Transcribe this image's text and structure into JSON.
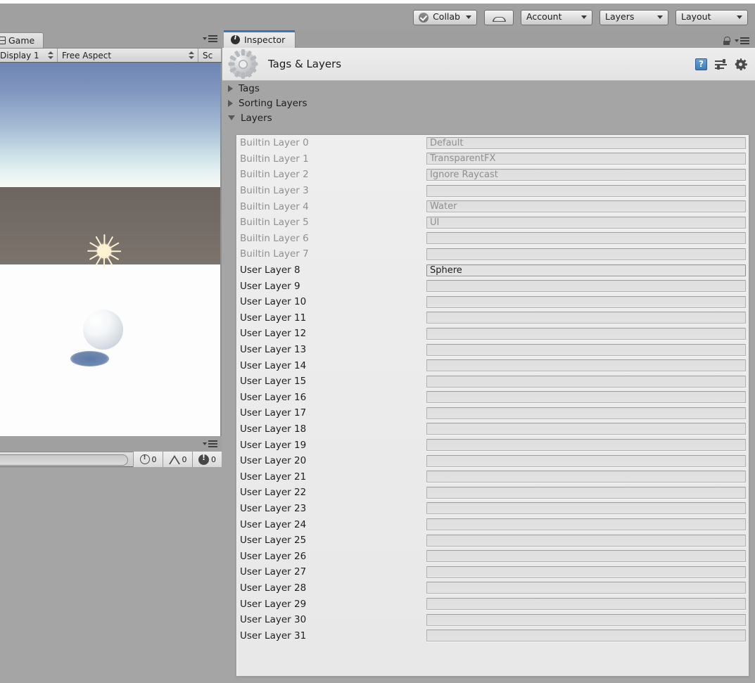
{
  "toolbar": {
    "collab_label": "Collab",
    "collab_icon": "check-circle-icon",
    "cloud_icon": "cloud-icon",
    "account_label": "Account",
    "layers_label": "Layers",
    "layout_label": "Layout"
  },
  "game_panel": {
    "tab_label": "Game",
    "tab_icon": "game-view-icon",
    "display_value": "Display 1",
    "aspect_value": "Free Aspect",
    "scale_value": "Sc",
    "panel_menu_icon": "panel-menu-icon"
  },
  "console_panel": {
    "search_placeholder": "",
    "error_count": "0",
    "warning_count": "0",
    "info_count": "0",
    "error_icon": "error-circle-icon",
    "warning_icon": "warning-triangle-icon",
    "info_icon": "info-filled-circle-icon",
    "panel_menu_icon": "panel-menu-icon"
  },
  "inspector": {
    "tab_label": "Inspector",
    "tab_icon": "info-icon",
    "lock_icon": "lock-icon",
    "panel_menu_icon": "panel-menu-icon",
    "title": "Tags & Layers",
    "title_icon": "gear-settings-icon",
    "help_icon": "help-book-icon",
    "preset_icon": "preset-sliders-icon",
    "gear_icon": "gear-icon",
    "foldouts": [
      {
        "label": "Tags",
        "expanded": false
      },
      {
        "label": "Sorting Layers",
        "expanded": false
      },
      {
        "label": "Layers",
        "expanded": true
      }
    ],
    "layer_rows": [
      {
        "label": "Builtin Layer 0",
        "value": "Default",
        "builtin": true,
        "active": false
      },
      {
        "label": "Builtin Layer 1",
        "value": "TransparentFX",
        "builtin": true,
        "active": false
      },
      {
        "label": "Builtin Layer 2",
        "value": "Ignore Raycast",
        "builtin": true,
        "active": false
      },
      {
        "label": "Builtin Layer 3",
        "value": "",
        "builtin": true,
        "active": false
      },
      {
        "label": "Builtin Layer 4",
        "value": "Water",
        "builtin": true,
        "active": false
      },
      {
        "label": "Builtin Layer 5",
        "value": "UI",
        "builtin": true,
        "active": false
      },
      {
        "label": "Builtin Layer 6",
        "value": "",
        "builtin": true,
        "active": false
      },
      {
        "label": "Builtin Layer 7",
        "value": "",
        "builtin": true,
        "active": false
      },
      {
        "label": "User Layer 8",
        "value": "Sphere",
        "builtin": false,
        "active": true
      },
      {
        "label": "User Layer 9",
        "value": "",
        "builtin": false,
        "active": false
      },
      {
        "label": "User Layer 10",
        "value": "",
        "builtin": false,
        "active": false
      },
      {
        "label": "User Layer 11",
        "value": "",
        "builtin": false,
        "active": false
      },
      {
        "label": "User Layer 12",
        "value": "",
        "builtin": false,
        "active": false
      },
      {
        "label": "User Layer 13",
        "value": "",
        "builtin": false,
        "active": false
      },
      {
        "label": "User Layer 14",
        "value": "",
        "builtin": false,
        "active": false
      },
      {
        "label": "User Layer 15",
        "value": "",
        "builtin": false,
        "active": false
      },
      {
        "label": "User Layer 16",
        "value": "",
        "builtin": false,
        "active": false
      },
      {
        "label": "User Layer 17",
        "value": "",
        "builtin": false,
        "active": false
      },
      {
        "label": "User Layer 18",
        "value": "",
        "builtin": false,
        "active": false
      },
      {
        "label": "User Layer 19",
        "value": "",
        "builtin": false,
        "active": false
      },
      {
        "label": "User Layer 20",
        "value": "",
        "builtin": false,
        "active": false
      },
      {
        "label": "User Layer 21",
        "value": "",
        "builtin": false,
        "active": false
      },
      {
        "label": "User Layer 22",
        "value": "",
        "builtin": false,
        "active": false
      },
      {
        "label": "User Layer 23",
        "value": "",
        "builtin": false,
        "active": false
      },
      {
        "label": "User Layer 24",
        "value": "",
        "builtin": false,
        "active": false
      },
      {
        "label": "User Layer 25",
        "value": "",
        "builtin": false,
        "active": false
      },
      {
        "label": "User Layer 26",
        "value": "",
        "builtin": false,
        "active": false
      },
      {
        "label": "User Layer 27",
        "value": "",
        "builtin": false,
        "active": false
      },
      {
        "label": "User Layer 28",
        "value": "",
        "builtin": false,
        "active": false
      },
      {
        "label": "User Layer 29",
        "value": "",
        "builtin": false,
        "active": false
      },
      {
        "label": "User Layer 30",
        "value": "",
        "builtin": false,
        "active": false
      },
      {
        "label": "User Layer 31",
        "value": "",
        "builtin": false,
        "active": false
      }
    ]
  },
  "scene": {
    "sun_icon": "sun-gizmo-icon",
    "sphere_object": "sphere",
    "shadow": "sphere-shadow"
  },
  "colors": {
    "accent_blue": "#3f72b5",
    "toolbar_grey": "#a0a0a0",
    "panel_bg": "#a5a5a5",
    "field_bg": "#e0e0e0",
    "sky_top": "#6e86b4",
    "ground": "#6d6560"
  }
}
